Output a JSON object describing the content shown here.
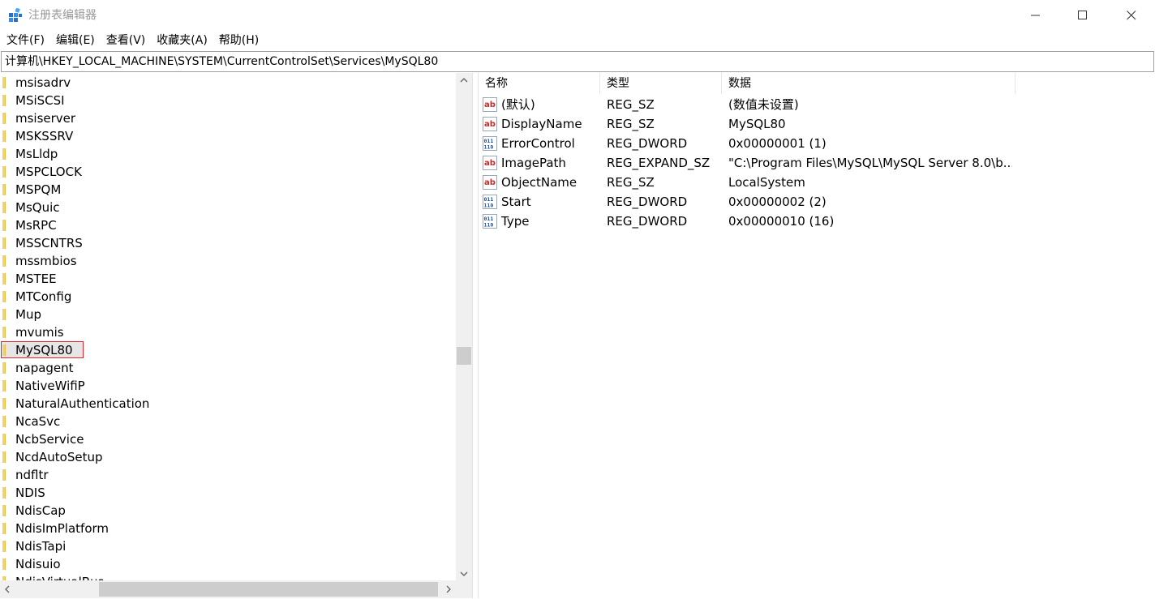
{
  "window": {
    "title": "注册表编辑器"
  },
  "menu": [
    {
      "label": "文件(F)"
    },
    {
      "label": "编辑(E)"
    },
    {
      "label": "查看(V)"
    },
    {
      "label": "收藏夹(A)"
    },
    {
      "label": "帮助(H)"
    }
  ],
  "address": {
    "path": "计算机\\HKEY_LOCAL_MACHINE\\SYSTEM\\CurrentControlSet\\Services\\MySQL80"
  },
  "tree": {
    "items": [
      {
        "label": "msisadrv"
      },
      {
        "label": "MSiSCSI"
      },
      {
        "label": "msiserver"
      },
      {
        "label": "MSKSSRV"
      },
      {
        "label": "MsLldp"
      },
      {
        "label": "MSPCLOCK"
      },
      {
        "label": "MSPQM"
      },
      {
        "label": "MsQuic"
      },
      {
        "label": "MsRPC"
      },
      {
        "label": "MSSCNTRS"
      },
      {
        "label": "mssmbios"
      },
      {
        "label": "MSTEE"
      },
      {
        "label": "MTConfig"
      },
      {
        "label": "Mup"
      },
      {
        "label": "mvumis"
      },
      {
        "label": "MySQL80",
        "selected": true
      },
      {
        "label": "napagent"
      },
      {
        "label": "NativeWifiP"
      },
      {
        "label": "NaturalAuthentication"
      },
      {
        "label": "NcaSvc"
      },
      {
        "label": "NcbService"
      },
      {
        "label": "NcdAutoSetup"
      },
      {
        "label": "ndfltr"
      },
      {
        "label": "NDIS"
      },
      {
        "label": "NdisCap"
      },
      {
        "label": "NdisImPlatform"
      },
      {
        "label": "NdisTapi"
      },
      {
        "label": "Ndisuio"
      },
      {
        "label": "NdisVirtualBus"
      }
    ]
  },
  "list": {
    "columns": {
      "name": "名称",
      "type": "类型",
      "data": "数据"
    },
    "rows": [
      {
        "icon": "string-value-icon",
        "name": "(默认)",
        "type": "REG_SZ",
        "data": "(数值未设置)"
      },
      {
        "icon": "string-value-icon",
        "name": "DisplayName",
        "type": "REG_SZ",
        "data": "MySQL80"
      },
      {
        "icon": "binary-value-icon",
        "name": "ErrorControl",
        "type": "REG_DWORD",
        "data": "0x00000001 (1)"
      },
      {
        "icon": "string-value-icon",
        "name": "ImagePath",
        "type": "REG_EXPAND_SZ",
        "data": "\"C:\\Program Files\\MySQL\\MySQL Server 8.0\\b..."
      },
      {
        "icon": "string-value-icon",
        "name": "ObjectName",
        "type": "REG_SZ",
        "data": "LocalSystem"
      },
      {
        "icon": "binary-value-icon",
        "name": "Start",
        "type": "REG_DWORD",
        "data": "0x00000002 (2)"
      },
      {
        "icon": "binary-value-icon",
        "name": "Type",
        "type": "REG_DWORD",
        "data": "0x00000010 (16)"
      }
    ]
  },
  "colors": {
    "folder": "#f5d36b",
    "selection_border": "#e1242a",
    "scrollbar_track": "#f0f0f0",
    "scrollbar_thumb": "#cdcdcd"
  }
}
